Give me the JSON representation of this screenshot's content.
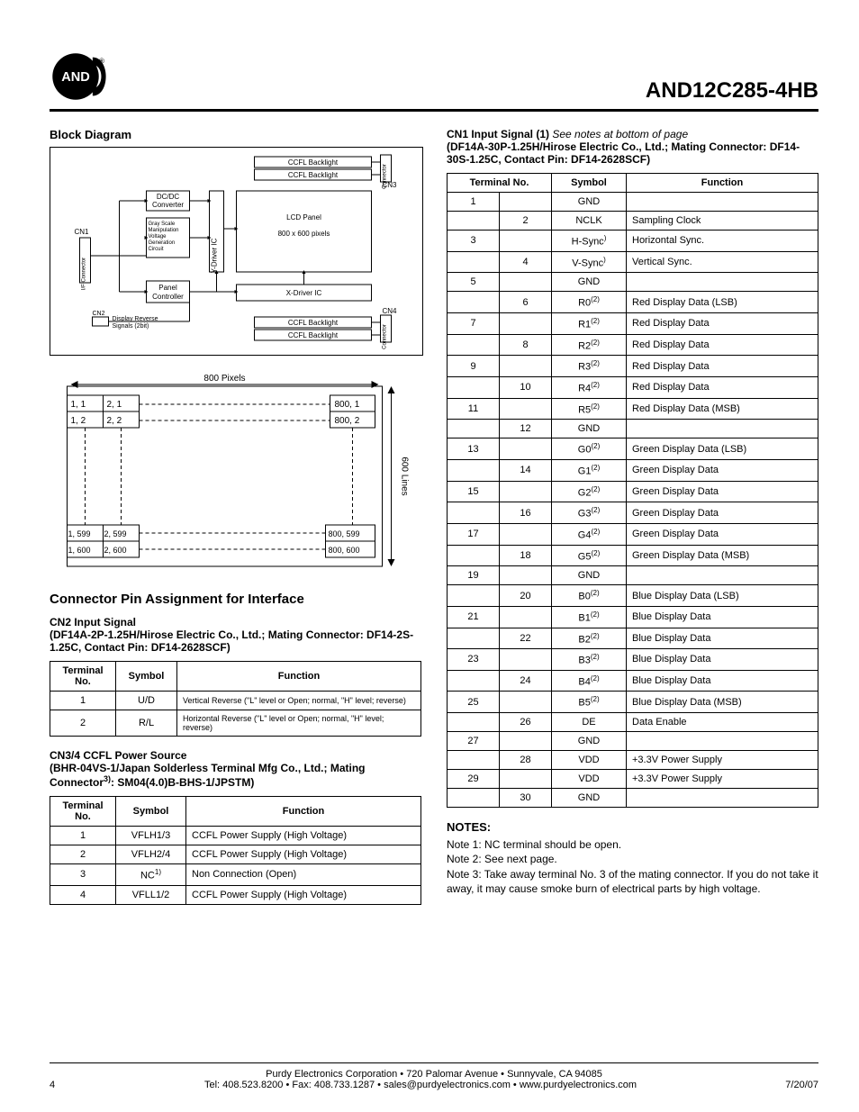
{
  "header": {
    "logo_text": "AND",
    "part_number": "AND12C285-4HB"
  },
  "left": {
    "block_diagram_title": "Block Diagram",
    "diagram_labels": {
      "dcdc": "DC/DC\nConverter",
      "gray": "Gray Scale\nManipulation\nVoltage\nGeneration\nCircuit",
      "ydriver": "Y-Driver IC",
      "lcd_panel": "LCD Panel",
      "lcd_pixels": "800 x 600 pixels",
      "panel_controller": "Panel\nController",
      "xdriver": "X-Driver IC",
      "ccfl": "CCFL Backlight",
      "cn1": "CN1",
      "cn2": "CN2",
      "cn3": "CN3",
      "cn4": "CN4",
      "conn": "Connector",
      "if_conn": "I/F Connector",
      "drs": "Display Reverse\nSignals (2bit)"
    },
    "pixel_grid": {
      "top_label": "800 Pixels",
      "right_label": "600 Lines",
      "cells": {
        "tl11": "1, 1",
        "tl21": "2, 1",
        "tr": "800, 1",
        "tl12": "1, 2",
        "tl22": "2, 2",
        "tr2": "800, 2",
        "bl1": "1, 599",
        "bl2": "2, 599",
        "br1": "800, 599",
        "bl3": "1, 600",
        "bl4": "2, 600",
        "br2": "800, 600"
      }
    },
    "connector_heading": "Connector Pin Assignment for Interface",
    "cn2": {
      "title": "CN2 Input Signal",
      "info": "(DF14A-2P-1.25H/Hirose Electric Co., Ltd.; Mating Connector: DF14-2S-1.25C, Contact Pin: DF14-2628SCF)",
      "cols": {
        "c1": "Terminal No.",
        "c2": "Symbol",
        "c3": "Function"
      },
      "rows": [
        {
          "no": "1",
          "sym": "U/D",
          "fn": "Vertical Reverse (\"L\" level or Open; normal, \"H\" level; reverse)"
        },
        {
          "no": "2",
          "sym": "R/L",
          "fn": "Horizontal Reverse (\"L\" level or Open; normal, \"H\" level; reverse)"
        }
      ]
    },
    "cn34": {
      "title": "CN3/4 CCFL Power Source",
      "info_a": "(BHR-04VS-1/Japan Solderless Terminal Mfg Co., Ltd.; Mating Connector",
      "info_sup": "3)",
      "info_b": ": SM04(4.0)B-BHS-1/JPSTM)",
      "cols": {
        "c1": "Terminal No.",
        "c2": "Symbol",
        "c3": "Function"
      },
      "rows": [
        {
          "no": "1",
          "sym": "VFLH1/3",
          "fn": "CCFL Power Supply (High Voltage)"
        },
        {
          "no": "2",
          "sym": "VFLH2/4",
          "fn": "CCFL Power Supply (High Voltage)"
        },
        {
          "no": "3",
          "sym": "NC",
          "sup": "1)",
          "fn": "Non Connection (Open)"
        },
        {
          "no": "4",
          "sym": "VFLL1/2",
          "fn": "CCFL Power Supply (High Voltage)"
        }
      ]
    }
  },
  "right": {
    "cn1": {
      "title": "CN1 Input Signal (1)",
      "title_note": "See notes at bottom of page",
      "info": "(DF14A-30P-1.25H/Hirose Electric Co., Ltd.; Mating Connector: DF14-30S-1.25C, Contact Pin: DF14-2628SCF)",
      "cols": {
        "c1a": "Terminal No.",
        "c2": "Symbol",
        "c3": "Function"
      },
      "rows": [
        {
          "a": "1",
          "b": "",
          "sym": "GND",
          "sup": "",
          "fn": ""
        },
        {
          "a": "",
          "b": "2",
          "sym": "NCLK",
          "sup": "",
          "fn": "Sampling Clock"
        },
        {
          "a": "3",
          "b": "",
          "sym": "H-Sync",
          "sup": ")",
          "fn": "Horizontal Sync."
        },
        {
          "a": "",
          "b": "4",
          "sym": "V-Sync",
          "sup": ")",
          "fn": "Vertical Sync."
        },
        {
          "a": "5",
          "b": "",
          "sym": "GND",
          "sup": "",
          "fn": ""
        },
        {
          "a": "",
          "b": "6",
          "sym": "R0",
          "sup": "(2)",
          "fn": "Red Display Data (LSB)"
        },
        {
          "a": "7",
          "b": "",
          "sym": "R1",
          "sup": "(2)",
          "fn": "Red Display Data"
        },
        {
          "a": "",
          "b": "8",
          "sym": "R2",
          "sup": "(2)",
          "fn": "Red Display Data"
        },
        {
          "a": "9",
          "b": "",
          "sym": "R3",
          "sup": "(2)",
          "fn": "Red Display Data"
        },
        {
          "a": "",
          "b": "10",
          "sym": "R4",
          "sup": "(2)",
          "fn": "Red Display Data"
        },
        {
          "a": "11",
          "b": "",
          "sym": "R5",
          "sup": "(2)",
          "fn": "Red Display Data (MSB)"
        },
        {
          "a": "",
          "b": "12",
          "sym": "GND",
          "sup": "",
          "fn": ""
        },
        {
          "a": "13",
          "b": "",
          "sym": "G0",
          "sup": "(2)",
          "fn": "Green Display Data (LSB)"
        },
        {
          "a": "",
          "b": "14",
          "sym": "G1",
          "sup": "(2)",
          "fn": "Green Display Data"
        },
        {
          "a": "15",
          "b": "",
          "sym": "G2",
          "sup": "(2)",
          "fn": "Green Display Data"
        },
        {
          "a": "",
          "b": "16",
          "sym": "G3",
          "sup": "(2)",
          "fn": "Green Display Data"
        },
        {
          "a": "17",
          "b": "",
          "sym": "G4",
          "sup": "(2)",
          "fn": "Green Display Data"
        },
        {
          "a": "",
          "b": "18",
          "sym": "G5",
          "sup": "(2)",
          "fn": "Green Display Data (MSB)"
        },
        {
          "a": "19",
          "b": "",
          "sym": "GND",
          "sup": "",
          "fn": ""
        },
        {
          "a": "",
          "b": "20",
          "sym": "B0",
          "sup": "(2)",
          "fn": "Blue Display Data (LSB)"
        },
        {
          "a": "21",
          "b": "",
          "sym": "B1",
          "sup": "(2)",
          "fn": "Blue Display Data"
        },
        {
          "a": "",
          "b": "22",
          "sym": "B2",
          "sup": "(2)",
          "fn": "Blue Display Data"
        },
        {
          "a": "23",
          "b": "",
          "sym": "B3",
          "sup": "(2)",
          "fn": "Blue Display Data"
        },
        {
          "a": "",
          "b": "24",
          "sym": "B4",
          "sup": "(2)",
          "fn": "Blue Display Data"
        },
        {
          "a": "25",
          "b": "",
          "sym": "B5",
          "sup": "(2)",
          "fn": "Blue Display Data (MSB)"
        },
        {
          "a": "",
          "b": "26",
          "sym": "DE",
          "sup": "",
          "fn": "Data Enable"
        },
        {
          "a": "27",
          "b": "",
          "sym": "GND",
          "sup": "",
          "fn": ""
        },
        {
          "a": "",
          "b": "28",
          "sym": "VDD",
          "sup": "",
          "fn": "+3.3V Power Supply"
        },
        {
          "a": "29",
          "b": "",
          "sym": "VDD",
          "sup": "",
          "fn": "+3.3V Power Supply"
        },
        {
          "a": "",
          "b": "30",
          "sym": "GND",
          "sup": "",
          "fn": ""
        }
      ]
    },
    "notes": {
      "heading": "NOTES:",
      "n1": "Note 1: NC terminal should be open.",
      "n2": "Note 2: See next page.",
      "n3": "Note 3: Take away terminal No. 3 of the mating connector. If you do not take it away, it may cause smoke burn of electrical parts by high voltage."
    }
  },
  "footer": {
    "page": "4",
    "line1": "Purdy Electronics Corporation  •  720 Palomar Avenue  •  Sunnyvale, CA 94085",
    "line2": "Tel: 408.523.8200  •  Fax: 408.733.1287  •  sales@purdyelectronics.com  •  www.purdyelectronics.com",
    "date": "7/20/07"
  }
}
